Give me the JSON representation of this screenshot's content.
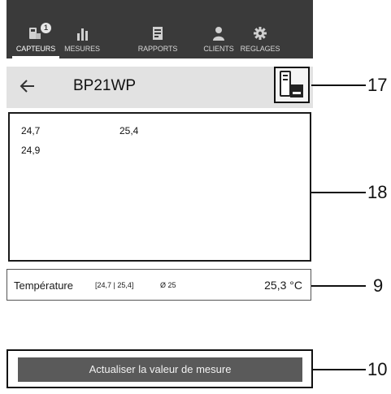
{
  "nav": {
    "items": [
      {
        "label": "CAPTEURS",
        "icon": "sensor-icon",
        "badge": "1",
        "active": true
      },
      {
        "label": "MESURES",
        "icon": "bar-chart-icon",
        "active": false
      },
      {
        "label": "RAPPORTS",
        "icon": "report-icon",
        "active": false
      },
      {
        "label": "CLIENTS",
        "icon": "person-icon",
        "active": false
      },
      {
        "label": "REGLAGES",
        "icon": "gear-icon",
        "active": false
      }
    ]
  },
  "header": {
    "back_icon": "back-arrow-icon",
    "device_name": "BP21WP",
    "probe_icon": "probe-device-icon"
  },
  "panel": {
    "values": [
      "24,7",
      "25,4",
      "24,9"
    ]
  },
  "measurement": {
    "label": "Température",
    "range": "[24,7 | 25,4]",
    "average": "Ø 25",
    "value": "25,3 °C"
  },
  "action": {
    "button_label": "Actualiser la valeur de mesure"
  },
  "callouts": {
    "header_icon": "17",
    "values_panel": "18",
    "measurement_row": "9",
    "update_button": "10"
  }
}
